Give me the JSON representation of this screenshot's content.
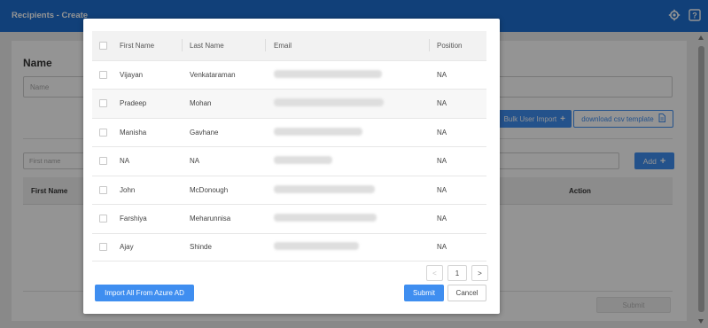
{
  "header": {
    "title": "Recipients - Create",
    "icons": [
      "gear-icon",
      "help-icon"
    ],
    "bg_color": "#1e6fd0"
  },
  "form": {
    "name_label": "Name",
    "name_placeholder": "Name",
    "bulk_import_label": "Bulk User Import",
    "csv_label": "download csv template",
    "first_name_placeholder": "First name",
    "add_label": "Add",
    "columns": {
      "first_name": "First Name",
      "action": "Action"
    },
    "submit_label": "Submit"
  },
  "modal": {
    "columns": {
      "first_name": "First Name",
      "last_name": "Last Name",
      "email": "Email",
      "position": "Position"
    },
    "rows": [
      {
        "first": "Vijayan",
        "last": "Venkataraman",
        "position": "NA"
      },
      {
        "first": "Pradeep",
        "last": "Mohan",
        "position": "NA"
      },
      {
        "first": "Manisha",
        "last": "Gavhane",
        "position": "NA"
      },
      {
        "first": "NA",
        "last": "NA",
        "position": "NA"
      },
      {
        "first": "John",
        "last": "McDonough",
        "position": "NA"
      },
      {
        "first": "Farshiya",
        "last": "Meharunnisa",
        "position": "NA"
      },
      {
        "first": "Ajay",
        "last": "Shinde",
        "position": "NA"
      }
    ],
    "pagination": {
      "prev": "<",
      "page": "1",
      "next": ">"
    },
    "import_label": "Import All From Azure AD",
    "submit_label": "Submit",
    "cancel_label": "Cancel"
  },
  "colors": {
    "accent": "#3f8ef0",
    "header": "#1e6fd0"
  }
}
